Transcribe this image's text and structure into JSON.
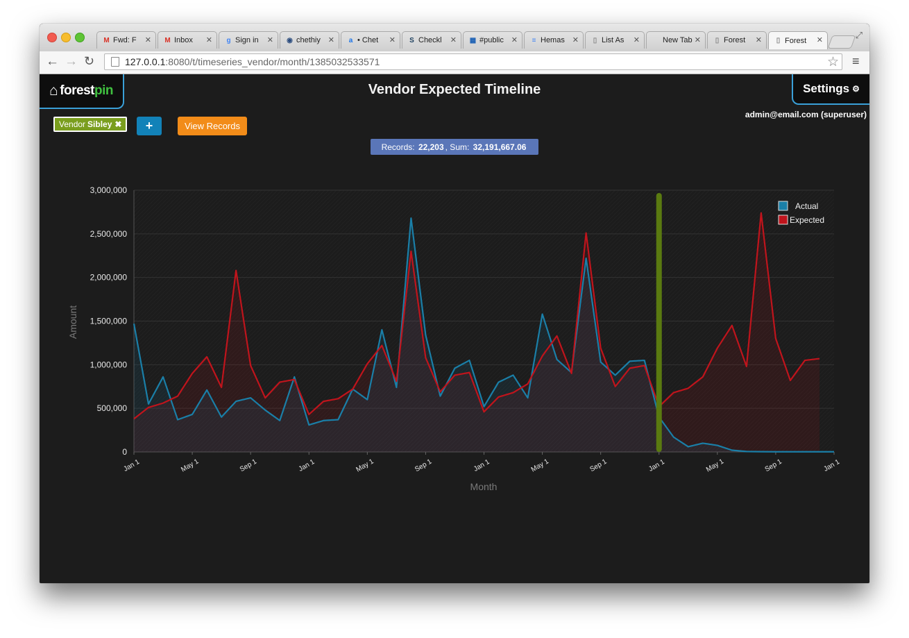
{
  "browser": {
    "tabs": [
      {
        "label": "Fwd: F",
        "icon": "M",
        "icon_color": "#d93025"
      },
      {
        "label": "Inbox",
        "icon": "M",
        "icon_color": "#d93025"
      },
      {
        "label": "Sign in",
        "icon": "g",
        "icon_color": "#4285f4"
      },
      {
        "label": "chethiy",
        "icon": "◉",
        "icon_color": "#2b4c7e"
      },
      {
        "label": "• Chet",
        "icon": "a",
        "icon_color": "#1a73e8"
      },
      {
        "label": "Checkl",
        "icon": "S",
        "icon_color": "#1c3f5e"
      },
      {
        "label": "#public",
        "icon": "▦",
        "icon_color": "#1a5fb4"
      },
      {
        "label": "Hemas",
        "icon": "≡",
        "icon_color": "#4285f4"
      },
      {
        "label": "List As",
        "icon": "▯",
        "icon_color": "#888888"
      },
      {
        "label": "New Tab",
        "icon": "",
        "icon_color": "#888888"
      },
      {
        "label": "Forest",
        "icon": "▯",
        "icon_color": "#888888"
      },
      {
        "label": "Forest",
        "icon": "▯",
        "icon_color": "#888888",
        "active": true
      }
    ],
    "url_host": "127.0.0.1",
    "url_path": ":8080/t/timeseries_vendor/month/1385032533571"
  },
  "app": {
    "logo_a": "forest",
    "logo_b": "pin",
    "title": "Vendor Expected Timeline",
    "settings_label": "Settings",
    "user": "admin@email.com (superuser)",
    "vendor_prefix": "Vendor",
    "vendor_name": "Sibley",
    "plus_label": "+",
    "view_records_label": "View Records",
    "records_label": "Records:",
    "records_value": "22,203",
    "sum_label": ", Sum:",
    "sum_value": "32,191,667.06"
  },
  "colors": {
    "actual": "#1a7fa8",
    "expected": "#c0141c",
    "marker": "#5a7a10"
  },
  "chart_data": {
    "type": "line",
    "xlabel": "Month",
    "ylabel": "Amount",
    "ylim": [
      0,
      3000000
    ],
    "yticks": [
      "0",
      "500,000",
      "1,000,000",
      "1,500,000",
      "2,000,000",
      "2,500,000",
      "3,000,000"
    ],
    "xtick_labels": [
      "Jan 1",
      "May 1",
      "Sep 1",
      "Jan 1",
      "May 1",
      "Sep 1",
      "Jan 1",
      "May 1",
      "Sep 1",
      "Jan 1",
      "May 1",
      "Sep 1",
      "Jan 1"
    ],
    "marker_index": 36,
    "series": [
      {
        "name": "Actual",
        "values": [
          1470000,
          550000,
          860000,
          370000,
          430000,
          710000,
          400000,
          580000,
          620000,
          480000,
          360000,
          860000,
          310000,
          360000,
          370000,
          720000,
          600000,
          1400000,
          740000,
          2680000,
          1340000,
          640000,
          960000,
          1050000,
          520000,
          800000,
          880000,
          620000,
          1580000,
          1060000,
          910000,
          2220000,
          1030000,
          880000,
          1040000,
          1050000,
          400000,
          170000,
          60000,
          100000,
          75000,
          20000,
          5000,
          3000,
          2000,
          2000,
          2000,
          2000,
          2000
        ]
      },
      {
        "name": "Expected",
        "values": [
          380000,
          510000,
          560000,
          640000,
          900000,
          1090000,
          740000,
          2080000,
          990000,
          620000,
          800000,
          830000,
          430000,
          580000,
          610000,
          720000,
          1010000,
          1220000,
          810000,
          2300000,
          1080000,
          690000,
          880000,
          910000,
          460000,
          630000,
          680000,
          780000,
          1100000,
          1330000,
          900000,
          2510000,
          1190000,
          750000,
          960000,
          990000,
          520000,
          680000,
          730000,
          860000,
          1190000,
          1450000,
          980000,
          2740000,
          1300000,
          820000,
          1050000,
          1070000
        ]
      }
    ]
  }
}
